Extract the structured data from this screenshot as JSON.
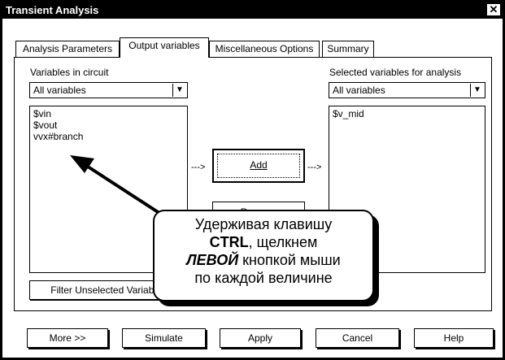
{
  "window": {
    "title": "Transient Analysis",
    "close_glyph": "✕"
  },
  "tabs": [
    {
      "label": "Analysis Parameters",
      "active": false
    },
    {
      "label": "Output variables",
      "active": true
    },
    {
      "label": "Miscellaneous Options",
      "active": false
    },
    {
      "label": "Summary",
      "active": false
    }
  ],
  "left": {
    "label": "Variables in circuit",
    "filter_value": "All variables",
    "items": [
      "$vin",
      "$vout",
      "vvx#branch"
    ],
    "filter_button": "Filter Unselected Variables"
  },
  "right": {
    "label": "Selected variables for analysis",
    "filter_value": "All variables",
    "items": [
      "$v_mid"
    ]
  },
  "middle": {
    "arrow": "--->",
    "add_label": "Add",
    "remove_label": "Remove"
  },
  "callout": {
    "line1": "Удерживая клавишу",
    "line2_bold": "CTRL",
    "line2_rest": ", щелкнем",
    "line3_bold": "ЛЕВОЙ",
    "line3_rest": " кнопкой мыши",
    "line4": "по каждой величине"
  },
  "footer": {
    "more": "More >>",
    "simulate": "Simulate",
    "apply": "Apply",
    "cancel": "Cancel",
    "help": "Help"
  }
}
